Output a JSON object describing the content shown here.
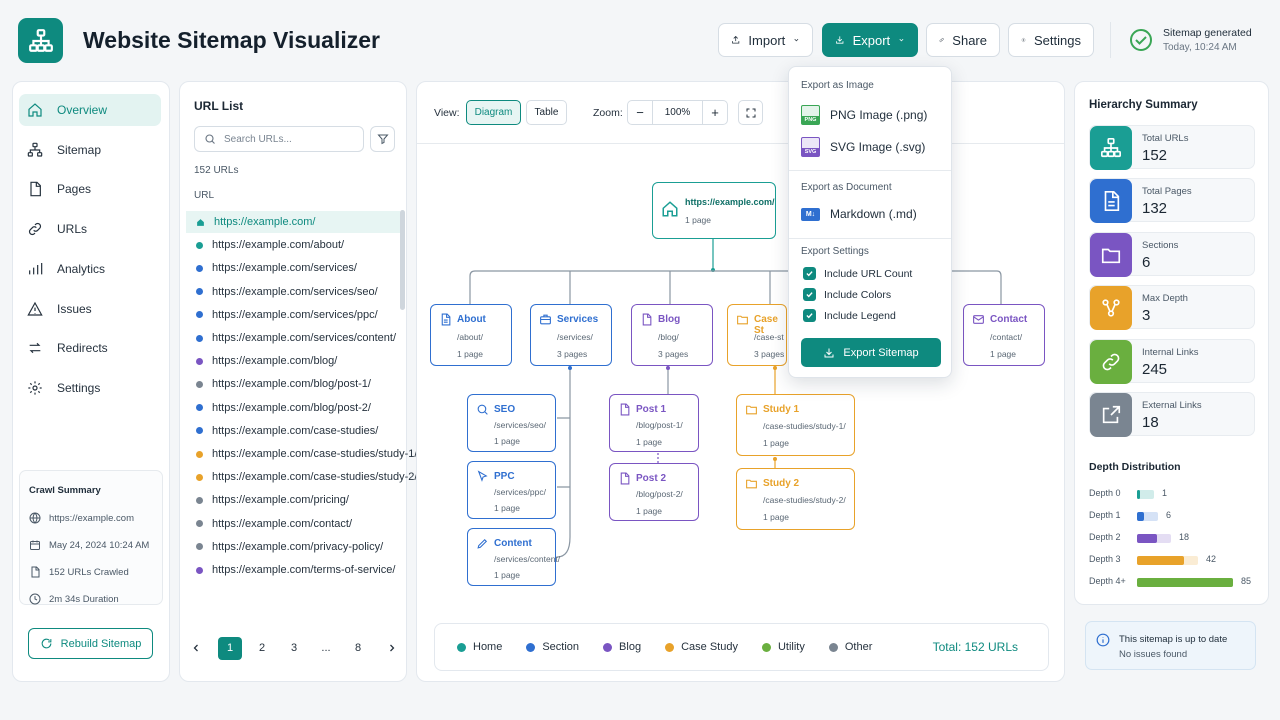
{
  "app": {
    "title": "Website Sitemap Visualizer"
  },
  "header": {
    "import_label": "Import",
    "export_label": "Export",
    "share_label": "Share",
    "settings_label": "Settings",
    "status_title": "Sitemap generated",
    "status_time": "Today, 10:24 AM"
  },
  "colors": {
    "accent": "#0e8a7f",
    "home": "#1a9e94",
    "section": "#2f6fd0",
    "blog": "#7a55c2",
    "case_study": "#e8a22a",
    "utility": "#6aaf3f",
    "other": "#7a8591"
  },
  "sidebar": {
    "items": [
      {
        "label": "Overview",
        "icon": "home-icon"
      },
      {
        "label": "Sitemap",
        "icon": "sitemap-icon"
      },
      {
        "label": "Pages",
        "icon": "page-icon"
      },
      {
        "label": "URLs",
        "icon": "link-icon"
      },
      {
        "label": "Analytics",
        "icon": "bar-chart-icon"
      },
      {
        "label": "Issues",
        "icon": "warning-icon"
      },
      {
        "label": "Redirects",
        "icon": "redirect-icon"
      },
      {
        "label": "Settings",
        "icon": "gear-icon"
      }
    ],
    "crawl_summary": {
      "title": "Crawl Summary",
      "site": "https://example.com",
      "date": "May 24, 2024 10:24 AM",
      "count": "152 URLs Crawled",
      "duration": "2m 34s Duration"
    },
    "rebuild_label": "Rebuild Sitemap"
  },
  "url_list": {
    "title": "URL List",
    "search_placeholder": "Search URLs...",
    "count": "152 URLs",
    "column": "URL",
    "rows": [
      {
        "url": "https://example.com/",
        "type": "home"
      },
      {
        "url": "https://example.com/about/",
        "type": "home"
      },
      {
        "url": "https://example.com/services/",
        "type": "section"
      },
      {
        "url": "https://example.com/services/seo/",
        "type": "section"
      },
      {
        "url": "https://example.com/services/ppc/",
        "type": "section"
      },
      {
        "url": "https://example.com/services/content/",
        "type": "section"
      },
      {
        "url": "https://example.com/blog/",
        "type": "blog"
      },
      {
        "url": "https://example.com/blog/post-1/",
        "type": "other"
      },
      {
        "url": "https://example.com/blog/post-2/",
        "type": "section"
      },
      {
        "url": "https://example.com/case-studies/",
        "type": "section"
      },
      {
        "url": "https://example.com/case-studies/study-1/",
        "type": "case_study"
      },
      {
        "url": "https://example.com/case-studies/study-2/",
        "type": "case_study"
      },
      {
        "url": "https://example.com/pricing/",
        "type": "other"
      },
      {
        "url": "https://example.com/contact/",
        "type": "other"
      },
      {
        "url": "https://example.com/privacy-policy/",
        "type": "other"
      },
      {
        "url": "https://example.com/terms-of-service/",
        "type": "blog"
      }
    ],
    "pagination": [
      "1",
      "2",
      "3",
      "...",
      "8"
    ],
    "current_page": "1"
  },
  "toolbar": {
    "view_label": "View:",
    "diagram_label": "Diagram",
    "table_label": "Table",
    "zoom_label": "Zoom:",
    "zoom_value": "100%",
    "minus": "−",
    "plus": "+"
  },
  "diagram": {
    "root": {
      "title": "https://example.com/",
      "count": "1 page"
    },
    "level1": [
      {
        "title": "About",
        "path": "/about/",
        "count": "1 page"
      },
      {
        "title": "Services",
        "path": "/services/",
        "count": "3 pages"
      },
      {
        "title": "Blog",
        "path": "/blog/",
        "count": "3 pages"
      },
      {
        "title": "Case St",
        "path": "/case-st",
        "count": "3 pages"
      },
      {
        "title": "Contact",
        "path": "/contact/",
        "count": "1 page"
      }
    ],
    "services_children": [
      {
        "title": "SEO",
        "path": "/services/seo/",
        "count": "1 page"
      },
      {
        "title": "PPC",
        "path": "/services/ppc/",
        "count": "1 page"
      },
      {
        "title": "Content",
        "path": "/services/content/",
        "count": "1 page"
      }
    ],
    "blog_children": [
      {
        "title": "Post 1",
        "path": "/blog/post-1/",
        "count": "1 page"
      },
      {
        "title": "Post 2",
        "path": "/blog/post-2/",
        "count": "1 page"
      }
    ],
    "case_children": [
      {
        "title": "Study 1",
        "path": "/case-studies/study-1/",
        "count": "1 page"
      },
      {
        "title": "Study 2",
        "path": "/case-studies/study-2/",
        "count": "1 page"
      }
    ]
  },
  "legend": {
    "items": [
      "Home",
      "Section",
      "Blog",
      "Case Study",
      "Utility",
      "Other"
    ],
    "total": "Total: 152 URLs"
  },
  "export_menu": {
    "image_header": "Export as Image",
    "png": "PNG Image (.png)",
    "svg": "SVG Image (.svg)",
    "png_badge": "PNG",
    "svg_badge": "SVG",
    "doc_header": "Export as Document",
    "md": "Markdown (.md)",
    "md_badge": "M↓",
    "settings_header": "Export Settings",
    "opt_count": "Include URL Count",
    "opt_colors": "Include Colors",
    "opt_legend": "Include Legend",
    "button": "Export Sitemap"
  },
  "summary": {
    "title": "Hierarchy Summary",
    "stats": [
      {
        "label": "Total URLs",
        "value": "152",
        "color": "#1a9e94"
      },
      {
        "label": "Total Pages",
        "value": "132",
        "color": "#2f6fd0"
      },
      {
        "label": "Sections",
        "value": "6",
        "color": "#7a55c2"
      },
      {
        "label": "Max Depth",
        "value": "3",
        "color": "#e8a22a"
      },
      {
        "label": "Internal Links",
        "value": "245",
        "color": "#6aaf3f"
      },
      {
        "label": "External Links",
        "value": "18",
        "color": "#7a8591"
      }
    ],
    "depth_title": "Depth Distribution",
    "depth": [
      {
        "label": "Depth 0",
        "value": 1,
        "display": "1",
        "color": "#1a9e94"
      },
      {
        "label": "Depth 1",
        "value": 6,
        "display": "6",
        "color": "#2f6fd0"
      },
      {
        "label": "Depth 2",
        "value": 18,
        "display": "18",
        "color": "#7a55c2"
      },
      {
        "label": "Depth 3",
        "value": 42,
        "display": "42",
        "color": "#e8a22a"
      },
      {
        "label": "Depth 4+",
        "value": 85,
        "display": "85",
        "color": "#6aaf3f"
      }
    ],
    "status_title": "This sitemap is up to date",
    "status_sub": "No issues found"
  }
}
